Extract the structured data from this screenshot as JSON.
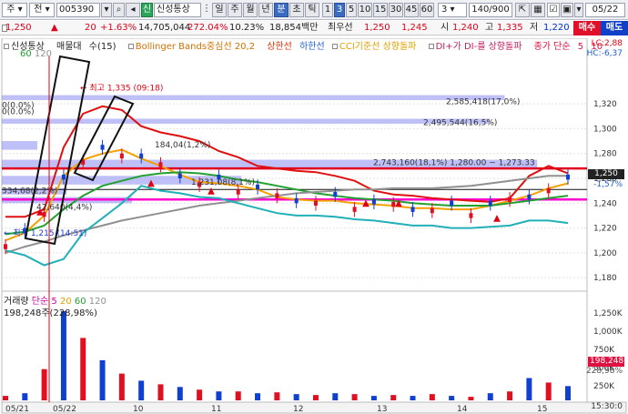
{
  "toolbar": {
    "market": "주",
    "type": "전",
    "code": "005390",
    "icon_search": "search-icon",
    "name": "신성통상",
    "periods": [
      "일",
      "주",
      "월",
      "년",
      "분",
      "초",
      "틱"
    ],
    "active_period": "분",
    "unit": "1",
    "minutes": [
      "3",
      "5",
      "10",
      "15",
      "30",
      "45",
      "60"
    ],
    "active_minute": "3",
    "multiplier": "3",
    "count": "140/900",
    "date": "05/22"
  },
  "quote": {
    "price": "1,250",
    "change": "20",
    "change_pct": "+1.63%",
    "volume": "14,705,044",
    "vol_ratio": "272.04%",
    "turnover": "10.23%",
    "amount": "18,854백만",
    "min_label": "최우선",
    "best_ask": "1,250",
    "best_bid": "1,245",
    "open_label": "시",
    "open": "1,240",
    "high_label": "고",
    "high": "1,335",
    "low_label": "저",
    "low": "1,220",
    "buy_label": "매수",
    "sell_label": "매도"
  },
  "legend": {
    "stock": "신성통상",
    "ma_tag": "매물대",
    "ma_count": "수(15)",
    "bb": "Bollinger Bands중심선 20,2",
    "bb_upper": "상한선",
    "bb_lower": "하한선",
    "cci": "CCI기준선 상향돌파",
    "dmi": "DI+가 DI-를 상향돌파",
    "close_ma": "종가 단순",
    "ma_periods": [
      "5",
      "10"
    ],
    "ma_sub": [
      "60",
      "120"
    ]
  },
  "chart_data": {
    "type": "line",
    "title": "",
    "ylim": [
      1175,
      1345
    ],
    "y_ticks": [
      1180,
      1200,
      1220,
      1240,
      1260,
      1280,
      1300,
      1320
    ],
    "y_tick_labels": [
      "1,180",
      "1,200",
      "1,220",
      "1,240",
      "1,260",
      "1,280",
      "1,300",
      "1,320"
    ],
    "x_tick_labels": [
      "05/21",
      "05/22",
      "10",
      "11",
      "12",
      "13",
      "14",
      "15"
    ],
    "hlines": {
      "red": 1268,
      "black": 1251,
      "magenta": 1243
    },
    "series": [
      {
        "name": "",
        "color": "#e01010",
        "values": [
          1229,
          1229,
          1235,
          1285,
          1312,
          1318,
          1315,
          1302,
          1297,
          1294,
          1290,
          1282,
          1277,
          1270,
          1268,
          1266,
          1265,
          1262,
          1258,
          1250,
          1247,
          1246,
          1244,
          1243,
          1242,
          1241,
          1244,
          1262,
          1270,
          1264
        ]
      },
      {
        "name": "",
        "color": "#f5a000",
        "values": [
          1210,
          1216,
          1230,
          1262,
          1275,
          1280,
          1283,
          1276,
          1270,
          1263,
          1257,
          1256,
          1254,
          1251,
          1245,
          1243,
          1242,
          1242,
          1240,
          1239,
          1238,
          1236,
          1236,
          1235,
          1235,
          1238,
          1242,
          1246,
          1252,
          1256
        ]
      },
      {
        "name": "",
        "color": "#22a030",
        "values": [
          1215,
          1217,
          1222,
          1235,
          1246,
          1254,
          1258,
          1262,
          1264,
          1265,
          1264,
          1262,
          1259,
          1257,
          1254,
          1251,
          1248,
          1246,
          1244,
          1243,
          1242,
          1240,
          1239,
          1238,
          1238,
          1238,
          1240,
          1242,
          1244,
          1246
        ]
      },
      {
        "name": "",
        "color": "#909090",
        "values": [
          1200,
          1205,
          1209,
          1214,
          1218,
          1222,
          1226,
          1229,
          1232,
          1235,
          1238,
          1240,
          1242,
          1244,
          1246,
          1248,
          1249,
          1250,
          1251,
          1251,
          1252,
          1252,
          1252,
          1253,
          1254,
          1256,
          1258,
          1260,
          1262,
          1262
        ]
      },
      {
        "name": "",
        "color": "#20b0b8",
        "values": [
          1202,
          1198,
          1190,
          1195,
          1216,
          1228,
          1240,
          1254,
          1250,
          1248,
          1245,
          1244,
          1240,
          1236,
          1232,
          1230,
          1230,
          1229,
          1227,
          1226,
          1224,
          1222,
          1222,
          1220,
          1220,
          1221,
          1222,
          1226,
          1226,
          1224
        ]
      }
    ],
    "volume": {
      "label": "거래량",
      "ma_label": "단순",
      "ma_periods": [
        "5",
        "20",
        "60",
        "120"
      ],
      "total": "198,248주(228,98%)",
      "y_tick_labels": [
        "1,250K",
        "1,000K",
        "750K",
        "500K",
        "250K"
      ],
      "last": "198,248",
      "last_pct": "228,98%"
    },
    "profile_labels": [
      "2,585,418(17,0%)",
      "2,495,544(16,5%)",
      "2,743,160(18,1%) 1,280.00 ~ 1,273.33",
      "184,04(1,2%)",
      "1,231,08(8,1%)",
      "334,68(2,2%)",
      "42,640(4,4%)",
      "0(0.0%)",
      "0(0.0%)"
    ],
    "annotations": {
      "high": "최고 1,335 (09:18)",
      "low": "최저 1,215 (14:51)"
    },
    "right_badges": {
      "lc": "LC:2,88",
      "hc": "HC:-6,37",
      "current": "1,250",
      "change": "-1,57%"
    },
    "time_label": "15:30:0"
  }
}
